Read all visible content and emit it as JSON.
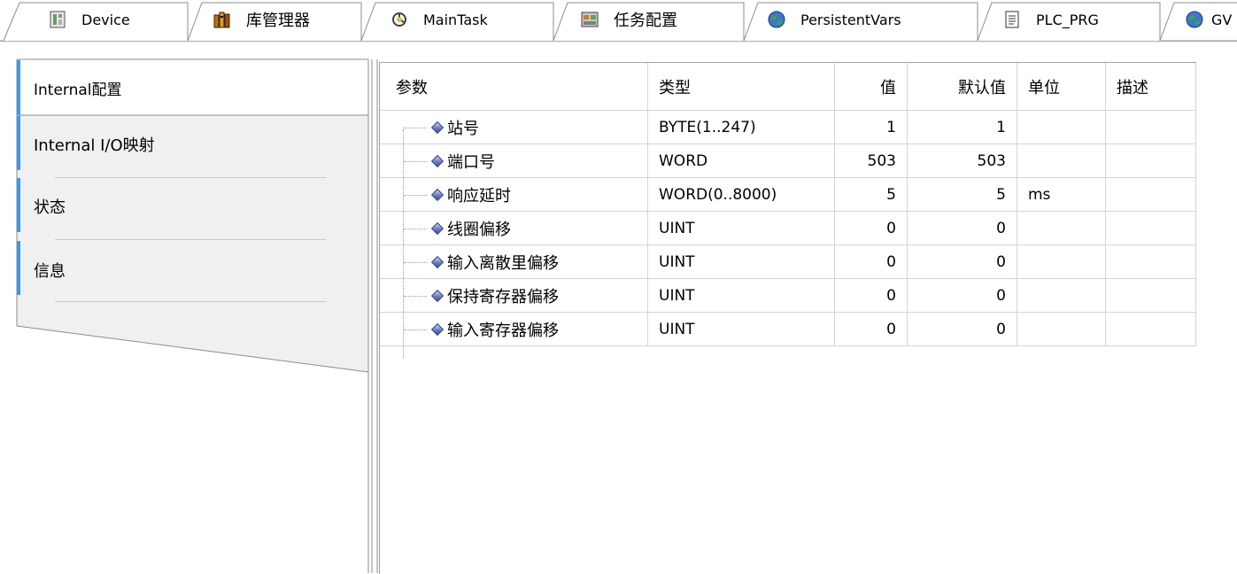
{
  "tabs": [
    {
      "label": "Device",
      "icon": "device-icon"
    },
    {
      "label": "库管理器",
      "icon": "library-icon"
    },
    {
      "label": "MainTask",
      "icon": "task-icon"
    },
    {
      "label": "任务配置",
      "icon": "task-config-icon"
    },
    {
      "label": "PersistentVars",
      "icon": "globe-icon"
    },
    {
      "label": "PLC_PRG",
      "icon": "document-icon"
    },
    {
      "label": "GV",
      "icon": "globe-icon"
    }
  ],
  "nav": {
    "items": [
      {
        "label": "Internal配置",
        "active": true
      },
      {
        "label": "Internal I/O映射",
        "active": false
      },
      {
        "label": "状态",
        "active": false
      },
      {
        "label": "信息",
        "active": false
      }
    ]
  },
  "table": {
    "headers": {
      "param": "参数",
      "type": "类型",
      "value": "值",
      "default": "默认值",
      "unit": "单位",
      "desc": "描述"
    },
    "rows": [
      {
        "name": "站号",
        "type": "BYTE(1..247)",
        "value": "1",
        "default": "1",
        "unit": "",
        "desc": ""
      },
      {
        "name": "端口号",
        "type": "WORD",
        "value": "503",
        "default": "503",
        "unit": "",
        "desc": ""
      },
      {
        "name": "响应延时",
        "type": "WORD(0..8000)",
        "value": "5",
        "default": "5",
        "unit": "ms",
        "desc": ""
      },
      {
        "name": "线圈偏移",
        "type": "UINT",
        "value": "0",
        "default": "0",
        "unit": "",
        "desc": ""
      },
      {
        "name": "输入离散里偏移",
        "type": "UINT",
        "value": "0",
        "default": "0",
        "unit": "",
        "desc": ""
      },
      {
        "name": "保持寄存器偏移",
        "type": "UINT",
        "value": "0",
        "default": "0",
        "unit": "",
        "desc": ""
      },
      {
        "name": "输入寄存器偏移",
        "type": "UINT",
        "value": "0",
        "default": "0",
        "unit": "",
        "desc": ""
      }
    ]
  },
  "colors": {
    "active_nav_accent": "#3399ff",
    "inactive_nav_bg": "#f0f0f0",
    "panel_border": "#8c8c8c",
    "grid_line": "#d4d4d4"
  }
}
